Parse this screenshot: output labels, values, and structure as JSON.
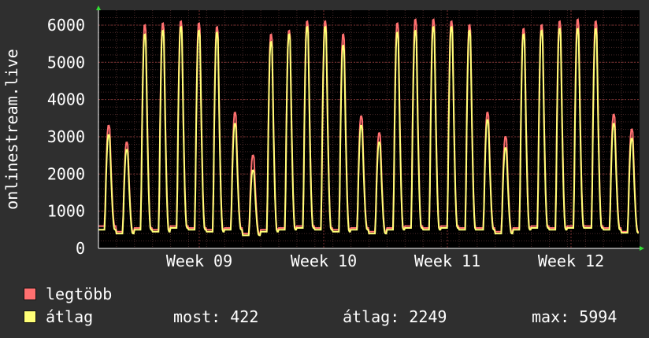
{
  "chart_data": {
    "type": "line",
    "ylabel": "onlinestream.live",
    "ylim": [
      0,
      6400
    ],
    "yticks": [
      0,
      1000,
      2000,
      3000,
      4000,
      5000,
      6000
    ],
    "xticks": [
      "Week 09",
      "Week 10",
      "Week 11",
      "Week 12"
    ],
    "grid": true,
    "series": [
      {
        "name": "legtöbb",
        "color": "#ff7070",
        "daily_peaks": [
          3300,
          2850,
          6000,
          6050,
          6100,
          6050,
          5950,
          3650,
          2500,
          5750,
          5850,
          6100,
          6100,
          5750,
          3550,
          3100,
          6050,
          6150,
          6150,
          6100,
          6000,
          3650,
          3000,
          5900,
          6000,
          6100,
          6150,
          6100,
          3600,
          3200
        ],
        "daily_troughs": [
          600,
          450,
          550,
          500,
          600,
          550,
          500,
          550,
          400,
          500,
          550,
          600,
          550,
          500,
          550,
          450,
          550,
          600,
          550,
          600,
          550,
          550,
          450,
          550,
          600,
          550,
          600,
          600,
          550,
          450
        ]
      },
      {
        "name": "átlag",
        "color": "#ffff77",
        "daily_peaks": [
          3050,
          2650,
          5750,
          5850,
          5950,
          5850,
          5800,
          3350,
          2100,
          5550,
          5750,
          5950,
          5950,
          5450,
          3300,
          2850,
          5800,
          5850,
          5950,
          5950,
          5850,
          3450,
          2700,
          5750,
          5850,
          5900,
          5900,
          5900,
          3350,
          2950
        ],
        "daily_troughs": [
          500,
          400,
          500,
          450,
          550,
          500,
          450,
          500,
          350,
          450,
          500,
          550,
          500,
          450,
          500,
          400,
          500,
          550,
          500,
          550,
          500,
          500,
          400,
          500,
          550,
          500,
          550,
          550,
          500,
          420
        ]
      }
    ]
  },
  "legend": {
    "max_label": "legtöbb",
    "avg_label": "átlag"
  },
  "stats": {
    "now": "most: 422",
    "avg": "átlag: 2249",
    "max": "max: 5994"
  }
}
